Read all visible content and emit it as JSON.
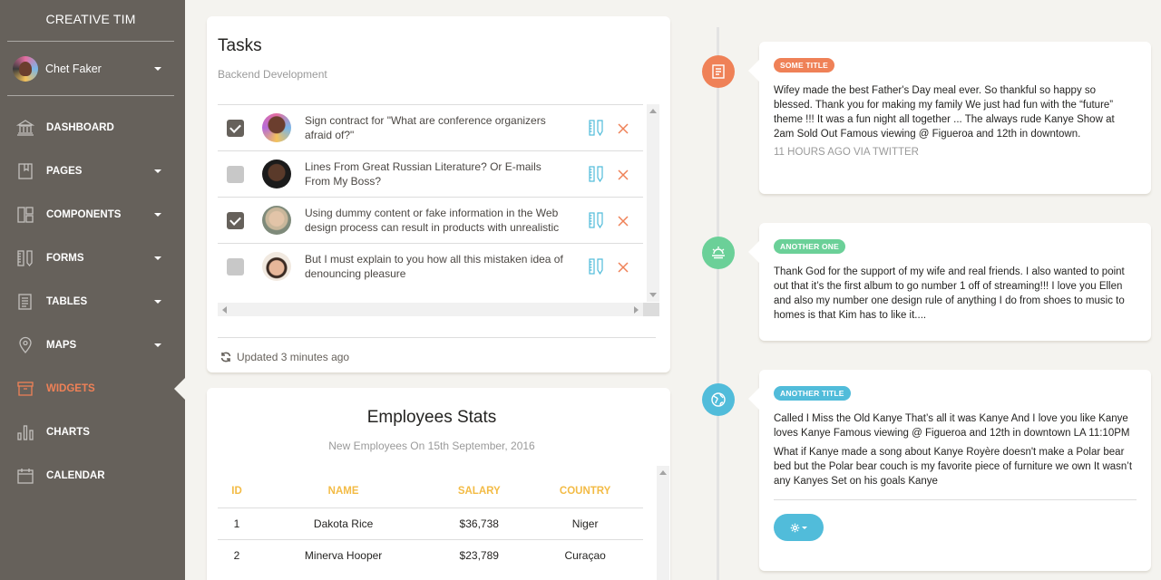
{
  "sidebar": {
    "brand": "CREATIVE TIM",
    "user": {
      "name": "Chet Faker"
    },
    "items": [
      {
        "label": "DASHBOARD",
        "icon": "bank-icon",
        "active": false,
        "has_caret": false
      },
      {
        "label": "PAGES",
        "icon": "book-bookmark-icon",
        "active": false,
        "has_caret": true
      },
      {
        "label": "COMPONENTS",
        "icon": "layout-icon",
        "active": false,
        "has_caret": true
      },
      {
        "label": "FORMS",
        "icon": "ruler-pencil-icon",
        "active": false,
        "has_caret": true
      },
      {
        "label": "TABLES",
        "icon": "paper-icon",
        "active": false,
        "has_caret": true
      },
      {
        "label": "MAPS",
        "icon": "pin-icon",
        "active": false,
        "has_caret": true
      },
      {
        "label": "WIDGETS",
        "icon": "box-icon",
        "active": true,
        "has_caret": false
      },
      {
        "label": "CHARTS",
        "icon": "chart-bar-icon",
        "active": false,
        "has_caret": false
      },
      {
        "label": "CALENDAR",
        "icon": "calendar-icon",
        "active": false,
        "has_caret": false
      }
    ]
  },
  "tasks": {
    "title": "Tasks",
    "subtitle": "Backend Development",
    "items": [
      {
        "checked": true,
        "text": "Sign contract for \"What are conference organizers afraid of?\""
      },
      {
        "checked": false,
        "text": "Lines From Great Russian Literature? Or E-mails From My Boss?"
      },
      {
        "checked": true,
        "text": "Using dummy content or fake information in the Web design process can result in products with unrealistic"
      },
      {
        "checked": false,
        "text": "But I must explain to you how all this mistaken idea of denouncing pleasure"
      }
    ],
    "footer": "Updated 3 minutes ago"
  },
  "employees": {
    "title": "Employees Stats",
    "subtitle": "New Employees On 15th September, 2016",
    "headers": [
      "ID",
      "NAME",
      "SALARY",
      "COUNTRY"
    ],
    "rows": [
      [
        "1",
        "Dakota Rice",
        "$36,738",
        "Niger"
      ],
      [
        "2",
        "Minerva Hooper",
        "$23,789",
        "Curaçao"
      ]
    ]
  },
  "timeline": [
    {
      "badge_color": "#ef8157",
      "icon": "article-icon",
      "pill": "SOME TITLE",
      "pill_color": "#ef8157",
      "paragraphs": [
        "Wifey made the best Father's Day meal ever. So thankful so happy so blessed. Thank you for making my family We just had fun with the “future” theme !!! It was a fun night all together ... The always rude Kanye Show at 2am Sold Out Famous viewing @ Figueroa and 12th in downtown."
      ],
      "meta": "11 HOURS AGO VIA TWITTER"
    },
    {
      "badge_color": "#6bd098",
      "icon": "sun-fog-icon",
      "pill": "ANOTHER ONE",
      "pill_color": "#6bd098",
      "paragraphs": [
        "Thank God for the support of my wife and real friends. I also wanted to point out that it’s the first album to go number 1 off of streaming!!! I love you Ellen and also my number one design rule of anything I do from shoes to music to homes is that Kim has to like it...."
      ]
    },
    {
      "badge_color": "#51bcda",
      "icon": "globe-icon",
      "pill": "ANOTHER TITLE",
      "pill_color": "#51bcda",
      "paragraphs": [
        "Called I Miss the Old Kanye That’s all it was Kanye And I love you like Kanye loves Kanye Famous viewing @ Figueroa and 12th in downtown LA 11:10PM",
        "What if Kanye made a song about Kanye Royère doesn't make a Polar bear bed but the Polar bear couch is my favorite piece of furniture we own It wasn’t any Kanyes Set on his goals Kanye"
      ]
    }
  ]
}
